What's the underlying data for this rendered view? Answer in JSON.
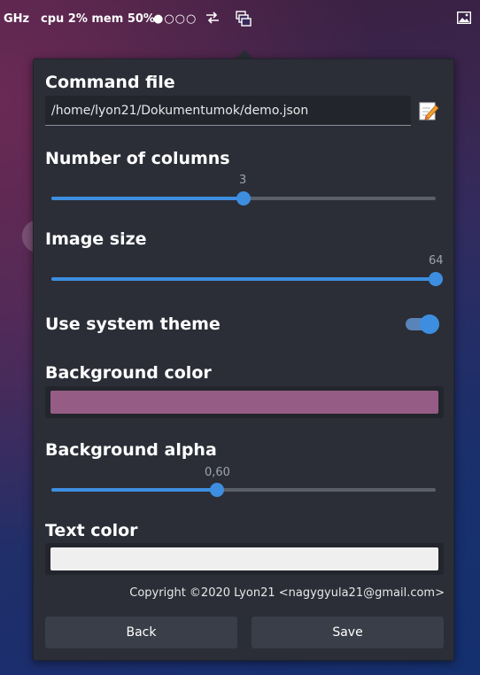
{
  "taskbar": {
    "freq_unit": "GHz",
    "cpu_mem": "cpu 2% mem 50%",
    "pager_dots": "●○○○"
  },
  "popup": {
    "command_file": {
      "label": "Command file",
      "value": "/home/lyon21/Dokumentumok/demo.json"
    },
    "columns": {
      "label": "Number of columns",
      "value_text": "3",
      "fraction": 0.5
    },
    "image_size": {
      "label": "Image size",
      "value_text": "64",
      "fraction": 1.0
    },
    "system_theme": {
      "label": "Use system theme",
      "enabled": true
    },
    "background_color": {
      "label": "Background color",
      "color": "#955d85"
    },
    "background_alpha": {
      "label": "Background alpha",
      "value_text": "0,60",
      "fraction": 0.43
    },
    "text_color": {
      "label": "Text color",
      "color": "#efefef"
    },
    "copyright": "Copyright ©2020 Lyon21 <nagygyula21@gmail.com>",
    "buttons": {
      "back": "Back",
      "save": "Save"
    }
  },
  "colors": {
    "accent": "#3d8ee0",
    "panel": "#2b2e37",
    "button": "#3a3e48"
  }
}
